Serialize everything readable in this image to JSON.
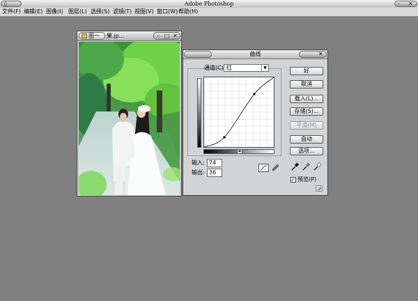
{
  "app": {
    "title": "Adobe Photoshop",
    "left_corner_icon": "ps-app-icon",
    "right_corner_icons": [
      "minimize-icon",
      "close-icon"
    ]
  },
  "menu": [
    "文件(F)",
    "编辑(E)",
    "图像(I)",
    "图层(L)",
    "选择(S)",
    "滤镜(T)",
    "视图(V)",
    "窗口(W)",
    "帮助(H)"
  ],
  "document": {
    "tab_label": "图一",
    "filename": "果.jp..."
  },
  "curves": {
    "title": "曲线",
    "channel_label": "通道(C):",
    "channel_value": "红",
    "input_label": "输入:",
    "input_value": "74",
    "output_label": "输出:",
    "output_value": "36",
    "buttons": {
      "ok": "好",
      "cancel": "取消",
      "load": "载入(L)...",
      "save": "存储(S)...",
      "smooth": "平滑(M)",
      "auto": "自动",
      "options": "选项..."
    },
    "preview_label": "预览(P)",
    "preview_checked": true,
    "curve_points": [
      [
        0,
        0
      ],
      [
        0.29,
        0.14
      ],
      [
        0.72,
        0.76
      ],
      [
        1,
        1
      ]
    ],
    "curve_color": "#000000"
  },
  "colors": {
    "workspace": "#808080",
    "dialog_bg": "#d2d3d4"
  }
}
